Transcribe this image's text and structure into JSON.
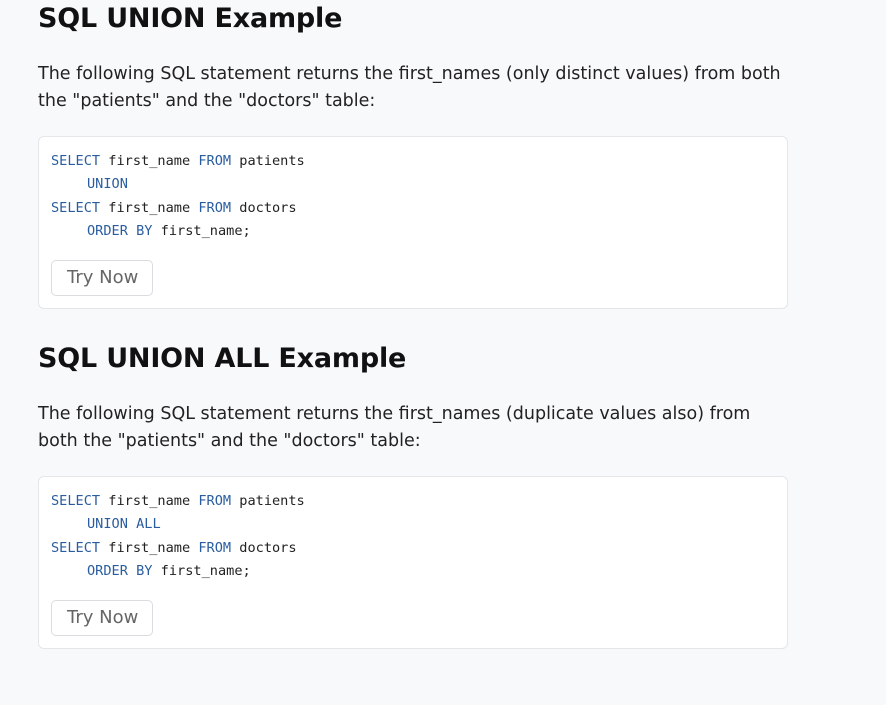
{
  "sections": [
    {
      "title": "SQL UNION Example",
      "description": "The following SQL statement returns the first_names (only distinct values) from both the \"patients\" and the \"doctors\" table:",
      "code": {
        "line1": {
          "kw1": "SELECT",
          "t1": " first_name ",
          "kw2": "FROM",
          "t2": " patients"
        },
        "line2": {
          "kw": "UNION"
        },
        "line3": {
          "kw1": "SELECT",
          "t1": " first_name ",
          "kw2": "FROM",
          "t2": " doctors"
        },
        "line4": {
          "kw": "ORDER BY",
          "t": " first_name;"
        }
      },
      "button_label": "Try Now"
    },
    {
      "title": "SQL UNION ALL Example",
      "description": "The following SQL statement returns the first_names (duplicate values also) from both the \"patients\" and the \"doctors\" table:",
      "code": {
        "line1": {
          "kw1": "SELECT",
          "t1": " first_name ",
          "kw2": "FROM",
          "t2": " patients"
        },
        "line2": {
          "kw": "UNION ALL"
        },
        "line3": {
          "kw1": "SELECT",
          "t1": " first_name ",
          "kw2": "FROM",
          "t2": " doctors"
        },
        "line4": {
          "kw": "ORDER BY",
          "t": " first_name;"
        }
      },
      "button_label": "Try Now"
    }
  ],
  "colors": {
    "keyword": "#2a5d9f",
    "background": "#f8f9fb",
    "card": "#ffffff"
  }
}
